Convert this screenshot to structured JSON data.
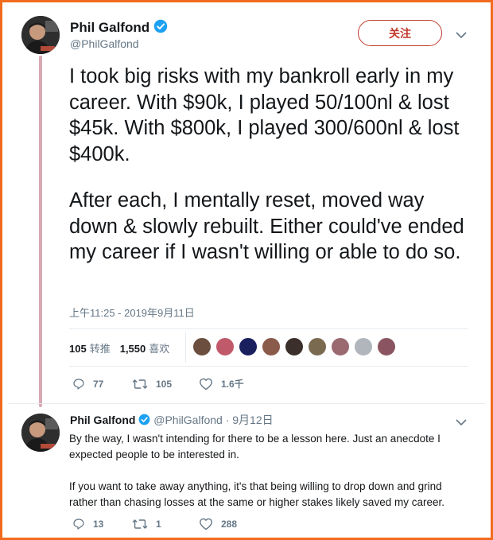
{
  "tweet": {
    "author_name": "Phil Galfond",
    "author_handle": "@PhilGalfond",
    "follow_label": "关注",
    "paragraphs": [
      "I took big risks with my bankroll early in my career. With $90k, I played 50/100nl & lost $45k. With $800k, I played 300/600nl & lost $400k.",
      "After each, I mentally reset, moved way down & slowly rebuilt. Either could've ended my career if I wasn't willing or able to do so."
    ],
    "timestamp": "上午11:25 - 2019年9月11日",
    "retweets_count": "105",
    "retweets_label": "转推",
    "likes_count": "1,550",
    "likes_label": "喜欢",
    "liker_avatar_colors": [
      "#6b4e3d",
      "#c05a6a",
      "#1a1f5e",
      "#8a5a4a",
      "#3a2f2a",
      "#7a6a50",
      "#9a6a70",
      "#b0b6bc",
      "#8a5560"
    ],
    "reply_count": "77",
    "retweet_action_count": "105",
    "like_action_count": "1.6千"
  },
  "reply": {
    "author_name": "Phil Galfond",
    "author_handle": "@PhilGalfond",
    "date": "· 9月12日",
    "paragraphs": [
      "By the way, I wasn't intending for there to be a lesson here. Just an anecdote I expected people to be interested in.",
      "If you want to take away anything, it's that being willing to drop down and grind rather than chasing losses at the same or higher stakes likely saved my career."
    ],
    "reply_count": "13",
    "retweet_count": "1",
    "like_count": "288"
  },
  "colors": {
    "frame": "#f26b1d",
    "thread_line": "#d9a8b3",
    "follow": "#c0392b",
    "verified": "#1da1f2",
    "muted": "#657786"
  }
}
